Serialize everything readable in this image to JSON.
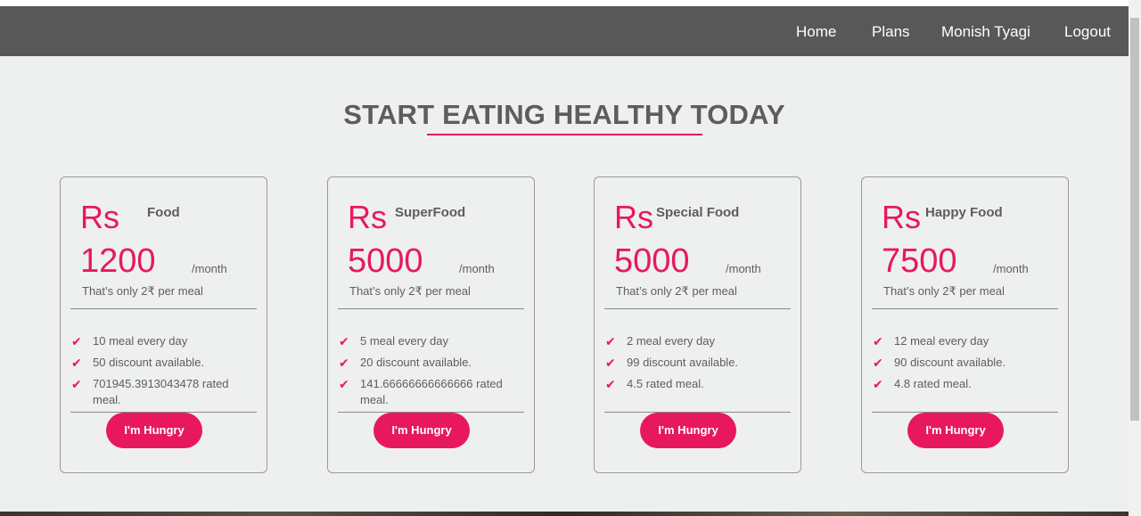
{
  "nav": {
    "home": "Home",
    "plans": "Plans",
    "user": "Monish Tyagi",
    "logout": "Logout"
  },
  "heading": "START EATING HEALTHY TODAY",
  "plans": [
    {
      "currency": "Rs",
      "name": "Food",
      "price": "1200",
      "period": "/month",
      "per_meal": "That’s only 2₹ per meal",
      "features": [
        "10 meal every day",
        "50 discount available.",
        "701945.3913043478 rated meal."
      ],
      "button": "I'm Hungry"
    },
    {
      "currency": "Rs",
      "name": "SuperFood",
      "price": "5000",
      "period": "/month",
      "per_meal": "That’s only 2₹ per meal",
      "features": [
        "5 meal every day",
        "20 discount available.",
        "141.66666666666666 rated meal."
      ],
      "button": "I'm Hungry"
    },
    {
      "currency": "Rs",
      "name": "Special Food",
      "price": "5000",
      "period": "/month",
      "per_meal": "That’s only 2₹ per meal",
      "features": [
        "2 meal every day",
        "99 discount available.",
        "4.5 rated meal."
      ],
      "button": "I'm Hungry"
    },
    {
      "currency": "Rs",
      "name": "Happy Food",
      "price": "7500",
      "period": "/month",
      "per_meal": "That’s only 2₹ per meal",
      "features": [
        "12 meal every day",
        "90 discount available.",
        "4.8 rated meal."
      ],
      "button": "I'm Hungry"
    }
  ],
  "colors": {
    "accent": "#e8185e",
    "navbar": "#585858",
    "background": "#eef0ef",
    "text": "#5d5d5d"
  },
  "icons": {
    "feature": "checkmark-icon"
  }
}
